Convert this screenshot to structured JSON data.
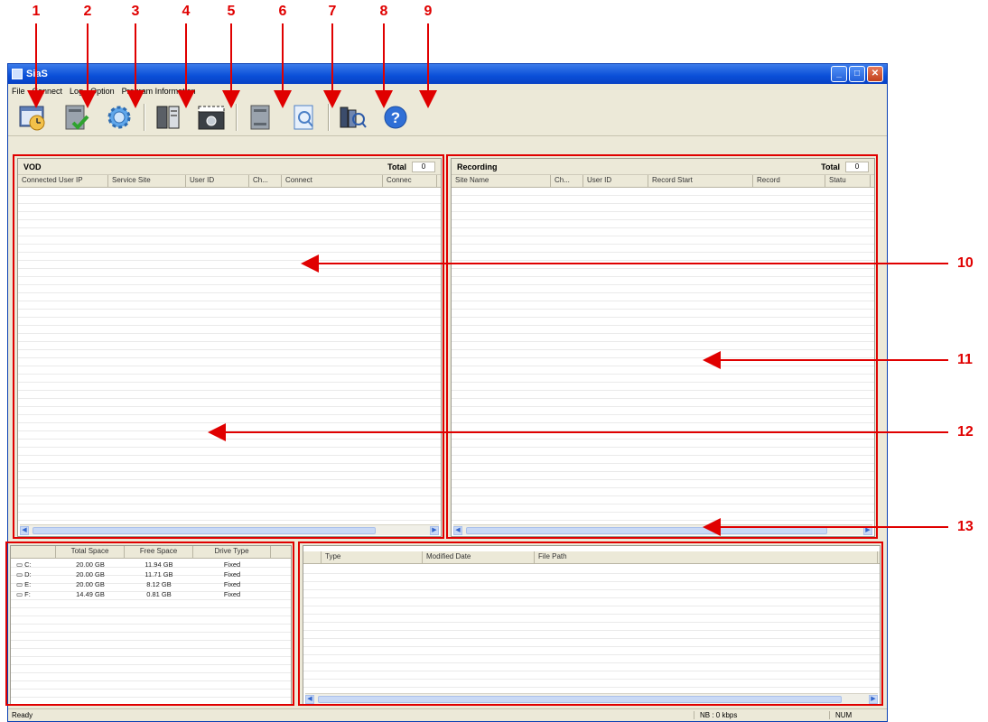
{
  "callouts": [
    "1",
    "2",
    "3",
    "4",
    "5",
    "6",
    "7",
    "8",
    "9"
  ],
  "side_callouts": [
    "10",
    "11",
    "12",
    "13"
  ],
  "window": {
    "title": "SiaS"
  },
  "menu": [
    "File",
    "Connect",
    "Log",
    "Option",
    "Program Information"
  ],
  "toolbar_icons": [
    "monitor-clock-icon",
    "server-check-icon",
    "gear-icon",
    "book-icon",
    "clapper-icon",
    "server-icon",
    "document-search-icon",
    "film-search-icon",
    "help-icon"
  ],
  "vod": {
    "title": "VOD",
    "total_label": "Total",
    "total_value": "0",
    "columns": [
      "Connected User IP",
      "Service Site",
      "User ID",
      "Ch...",
      "Connect",
      "Connec"
    ]
  },
  "recording": {
    "title": "Recording",
    "total_label": "Total",
    "total_value": "0",
    "columns": [
      "Site Name",
      "Ch...",
      "User ID",
      "Record Start",
      "Record",
      "Statu"
    ]
  },
  "drives": {
    "columns": [
      "",
      "Total Space",
      "Free Space",
      "Drive Type"
    ],
    "rows": [
      {
        "drive": "C:",
        "total": "20.00 GB",
        "free": "11.94 GB",
        "type": "Fixed"
      },
      {
        "drive": "D:",
        "total": "20.00 GB",
        "free": "11.71 GB",
        "type": "Fixed"
      },
      {
        "drive": "E:",
        "total": "20.00 GB",
        "free": "8.12 GB",
        "type": "Fixed"
      },
      {
        "drive": "F:",
        "total": "14.49 GB",
        "free": "0.81 GB",
        "type": "Fixed"
      }
    ]
  },
  "files": {
    "columns": [
      "Type",
      "Modified Date",
      "File Path"
    ]
  },
  "status": {
    "left": "Ready",
    "nb": "NB : 0 kbps",
    "num": "NUM"
  },
  "colors": {
    "annotation": "#e00000",
    "titlebar": "#0a4fd8"
  }
}
